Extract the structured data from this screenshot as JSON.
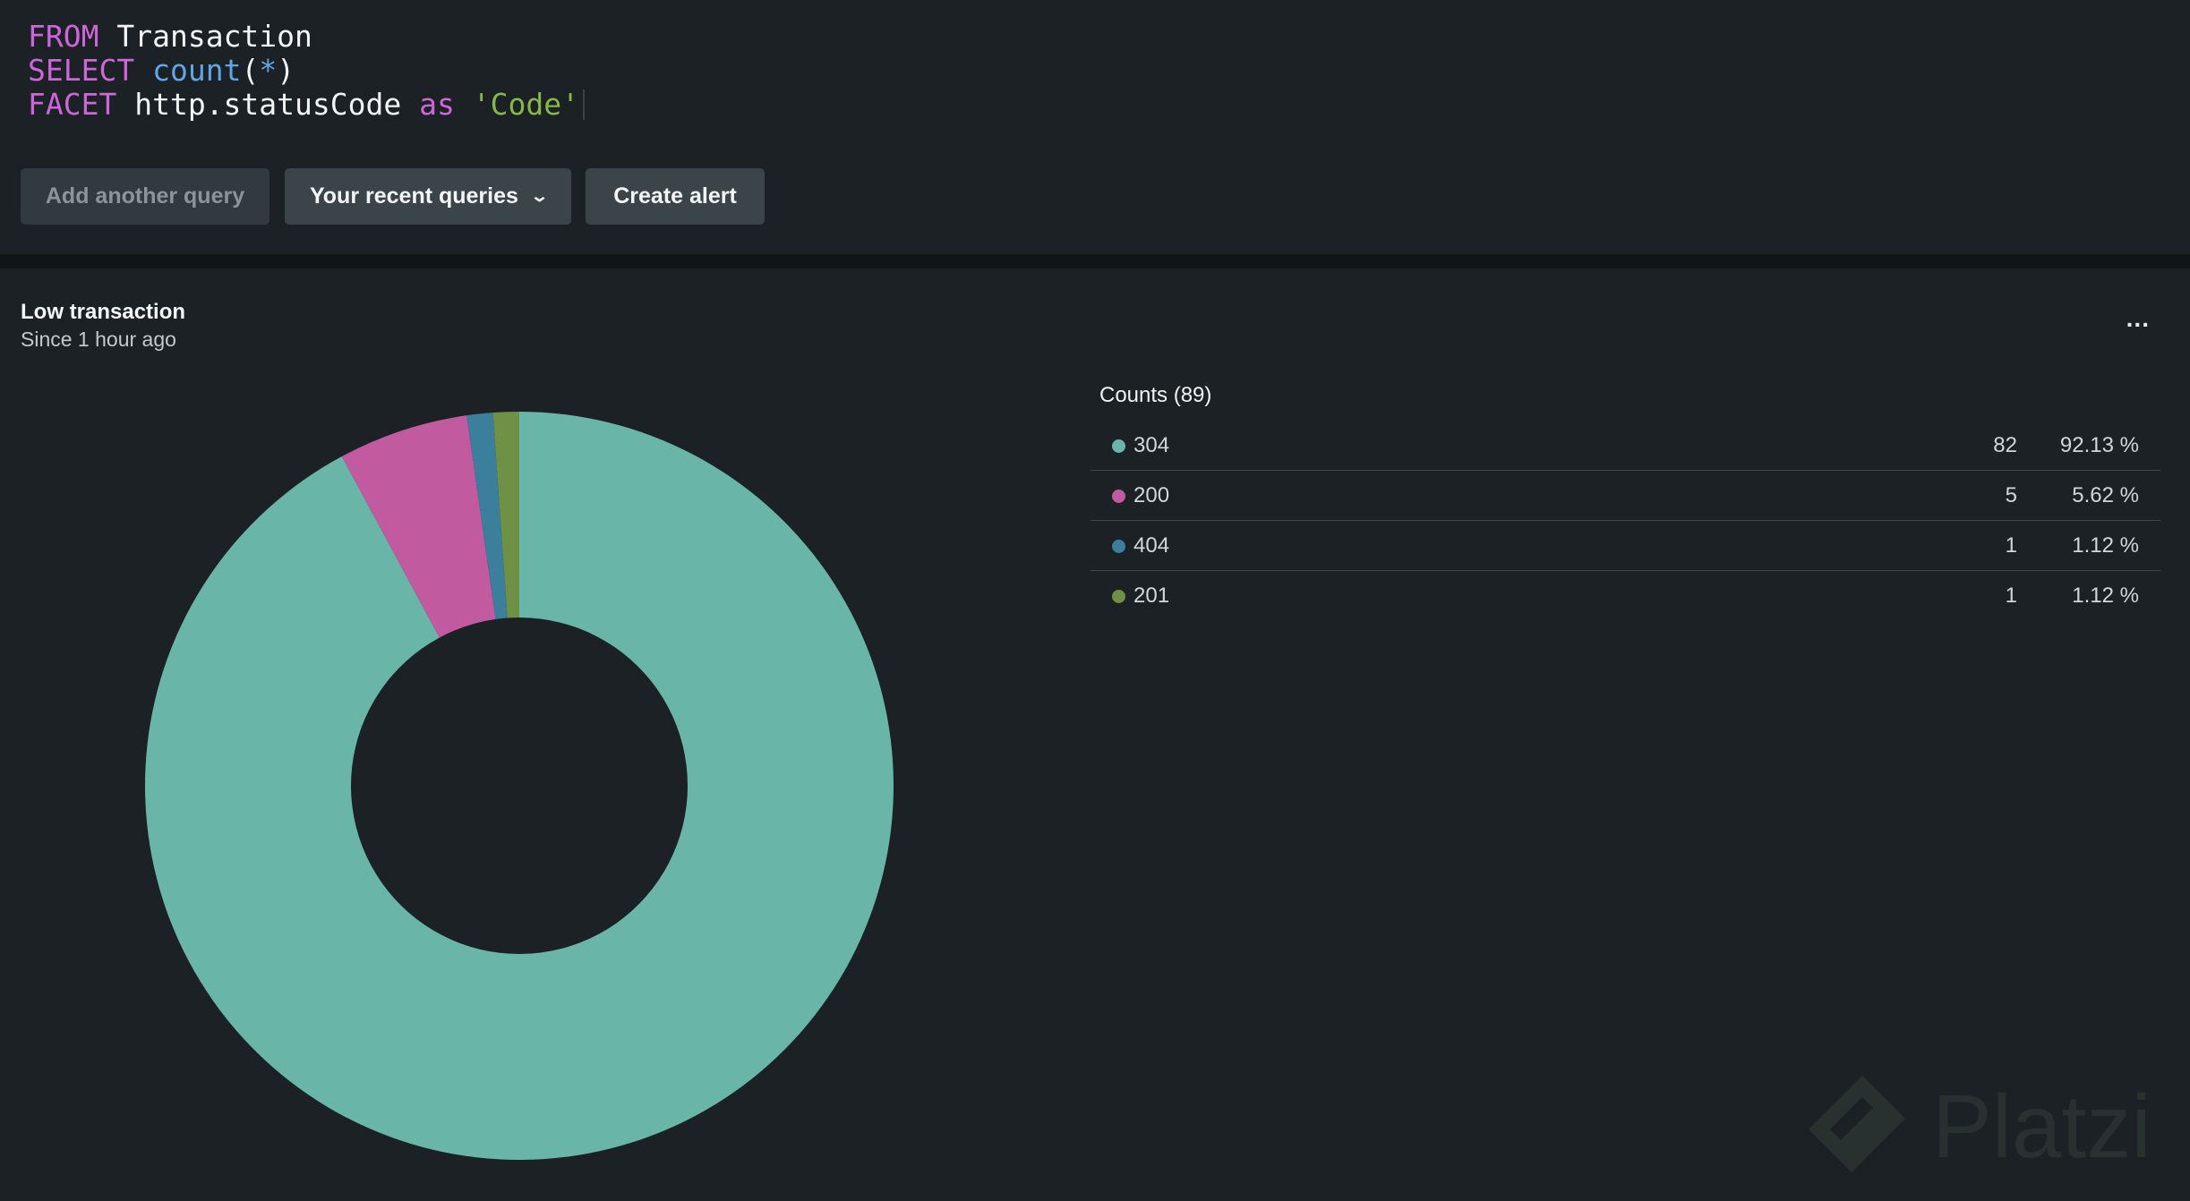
{
  "editor": {
    "line1": {
      "kw": "FROM",
      "ident": "Transaction"
    },
    "line2": {
      "kw": "SELECT",
      "fn": "count",
      "open": "(",
      "star": "*",
      "close": ")"
    },
    "line3": {
      "kw": "FACET",
      "ident": "http.statusCode",
      "as": "as",
      "str": "'Code'"
    }
  },
  "buttons": {
    "add_query": "Add another query",
    "recent_queries": "Your recent queries",
    "create_alert": "Create alert"
  },
  "widget": {
    "title": "Low transaction",
    "subtitle": "Since 1 hour ago",
    "menu": "...",
    "legend_header": "Counts (89)"
  },
  "watermark": {
    "text": "Platzi"
  },
  "colors": {
    "304": "#69b6a8",
    "200": "#c25aa0",
    "404": "#3c7f9c",
    "201": "#6e9146",
    "hole": "#1b2124"
  },
  "chart_data": {
    "type": "pie",
    "donut": true,
    "title": "Low transaction",
    "total": 89,
    "categories": [
      "304",
      "200",
      "404",
      "201"
    ],
    "values": [
      82,
      5,
      1,
      1
    ],
    "percentages": [
      "92.13 %",
      "5.62 %",
      "1.12 %",
      "1.12 %"
    ],
    "legend_placement": "right"
  }
}
